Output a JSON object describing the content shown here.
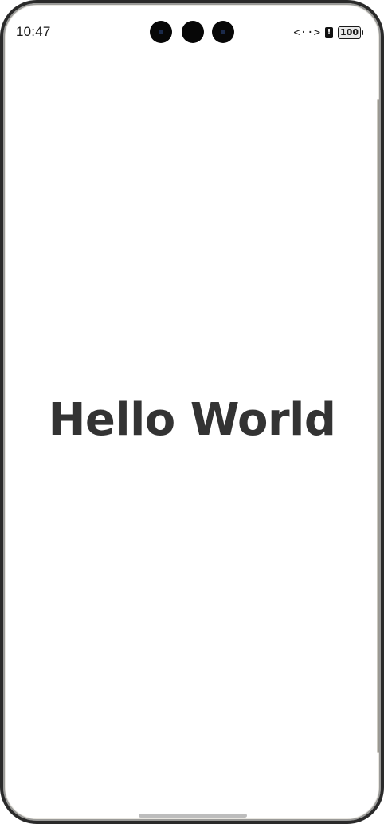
{
  "status_bar": {
    "time": "10:47",
    "data_indicator": "<··>",
    "alert_glyph": "!",
    "battery_level": "100",
    "icons": [
      "front-camera-icon",
      "data-transfer-icon",
      "alert-icon",
      "battery-icon"
    ]
  },
  "main": {
    "title": "Hello World"
  },
  "colors": {
    "text": "#333333",
    "background": "#ffffff"
  }
}
